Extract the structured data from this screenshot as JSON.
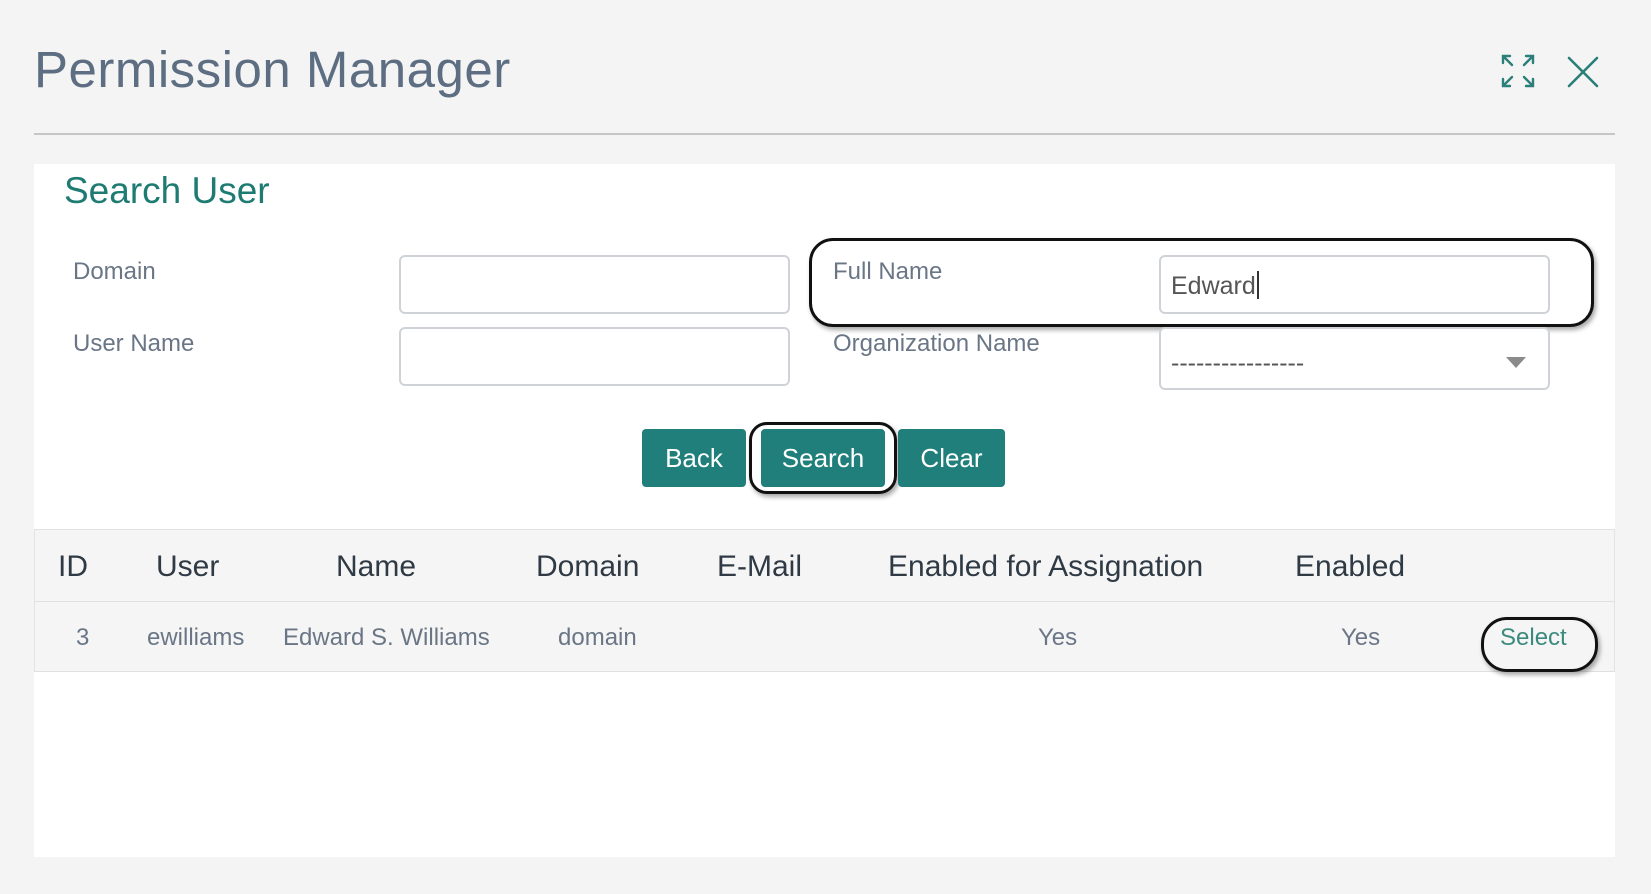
{
  "window": {
    "title": "Permission Manager",
    "icons": {
      "expand": "expand-icon",
      "close": "close-icon"
    }
  },
  "search": {
    "title": "Search User",
    "fields": {
      "domain": {
        "label": "Domain",
        "value": ""
      },
      "full_name": {
        "label": "Full Name",
        "value": "Edward"
      },
      "user_name": {
        "label": "User Name",
        "value": ""
      },
      "organization_name": {
        "label": "Organization Name",
        "selected": "----------------"
      }
    },
    "buttons": {
      "back": "Back",
      "search": "Search",
      "clear": "Clear"
    }
  },
  "results": {
    "columns": [
      "ID",
      "User",
      "Name",
      "Domain",
      "E-Mail",
      "Enabled for Assignation",
      "Enabled"
    ],
    "rows": [
      {
        "id": "3",
        "user": "ewilliams",
        "name": "Edward S. Williams",
        "domain": "domain",
        "email": "",
        "enabled_for_assignation": "Yes",
        "enabled": "Yes",
        "action": "Select"
      }
    ]
  },
  "colors": {
    "accent": "#207f7a",
    "title": "#5e6e82",
    "section_title": "#1e7b72"
  }
}
